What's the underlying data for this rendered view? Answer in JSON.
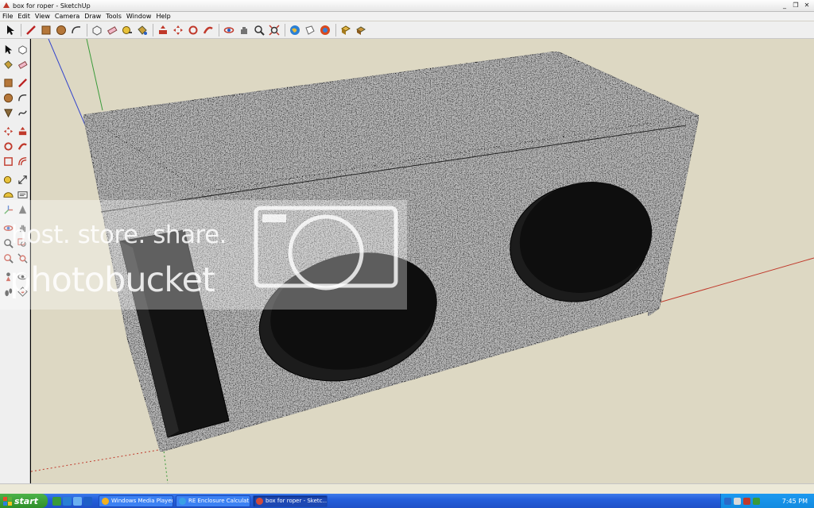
{
  "window": {
    "title": "box for roper - SketchUp",
    "controls": [
      "minimize",
      "restore",
      "close"
    ]
  },
  "menubar": {
    "items": [
      "File",
      "Edit",
      "View",
      "Camera",
      "Draw",
      "Tools",
      "Window",
      "Help"
    ]
  },
  "toolbar": {
    "icons": [
      "select-icon",
      "pencil-icon",
      "rectangle-icon",
      "circle-icon",
      "arc-icon",
      "make-component-icon",
      "eraser-icon",
      "tape-measure-icon",
      "paint-bucket-icon",
      "push-pull-icon",
      "move-icon",
      "rotate-icon",
      "follow-me-icon",
      "orbit-icon",
      "pan-icon",
      "zoom-icon",
      "zoom-extents-icon",
      "get-models-icon",
      "share-model-icon",
      "google-earth-icon",
      "components-icon",
      "materials-icon"
    ]
  },
  "watermark": {
    "line1": "host. store. share.",
    "line2": "photobucket"
  },
  "taskbar": {
    "start_label": "start",
    "tasks": [
      {
        "label": "Windows Media Player",
        "active": false,
        "color": "#f2b01e"
      },
      {
        "label": "RE Enclosure Calculat...",
        "active": false,
        "color": "#3aa0e6"
      },
      {
        "label": "box for roper - Sketc...",
        "active": true,
        "color": "#d24a3a"
      }
    ],
    "clock": "7:45 PM"
  },
  "colors": {
    "viewport_bg": "#ddd8c3",
    "box_carpet": "#5a5a5a",
    "axis_red": "#c0392b",
    "axis_green": "#3a9a3a",
    "axis_blue": "#3344cc"
  }
}
